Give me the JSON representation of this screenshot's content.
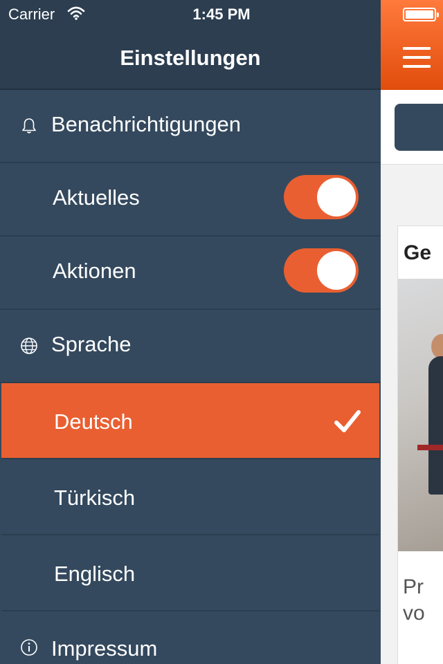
{
  "status_bar": {
    "carrier": "Carrier",
    "time": "1:45 PM"
  },
  "sidebar": {
    "title": "Einstellungen",
    "notifications": {
      "label": "Benachrichtigungen",
      "icon": "bell-icon",
      "items": [
        {
          "label": "Aktuelles",
          "on": true
        },
        {
          "label": "Aktionen",
          "on": true
        }
      ]
    },
    "language": {
      "label": "Sprache",
      "icon": "globe-icon",
      "options": [
        {
          "label": "Deutsch",
          "selected": true
        },
        {
          "label": "Türkisch",
          "selected": false
        },
        {
          "label": "Englisch",
          "selected": false
        }
      ]
    },
    "imprint": {
      "label": "Impressum",
      "icon": "info-icon"
    }
  },
  "content": {
    "card_title": "Ge",
    "card_text_line1": "Pr",
    "card_text_line2": "vo"
  },
  "colors": {
    "accent": "#e95f31",
    "sidebar": "#34495e",
    "header": "#2c3e50"
  }
}
